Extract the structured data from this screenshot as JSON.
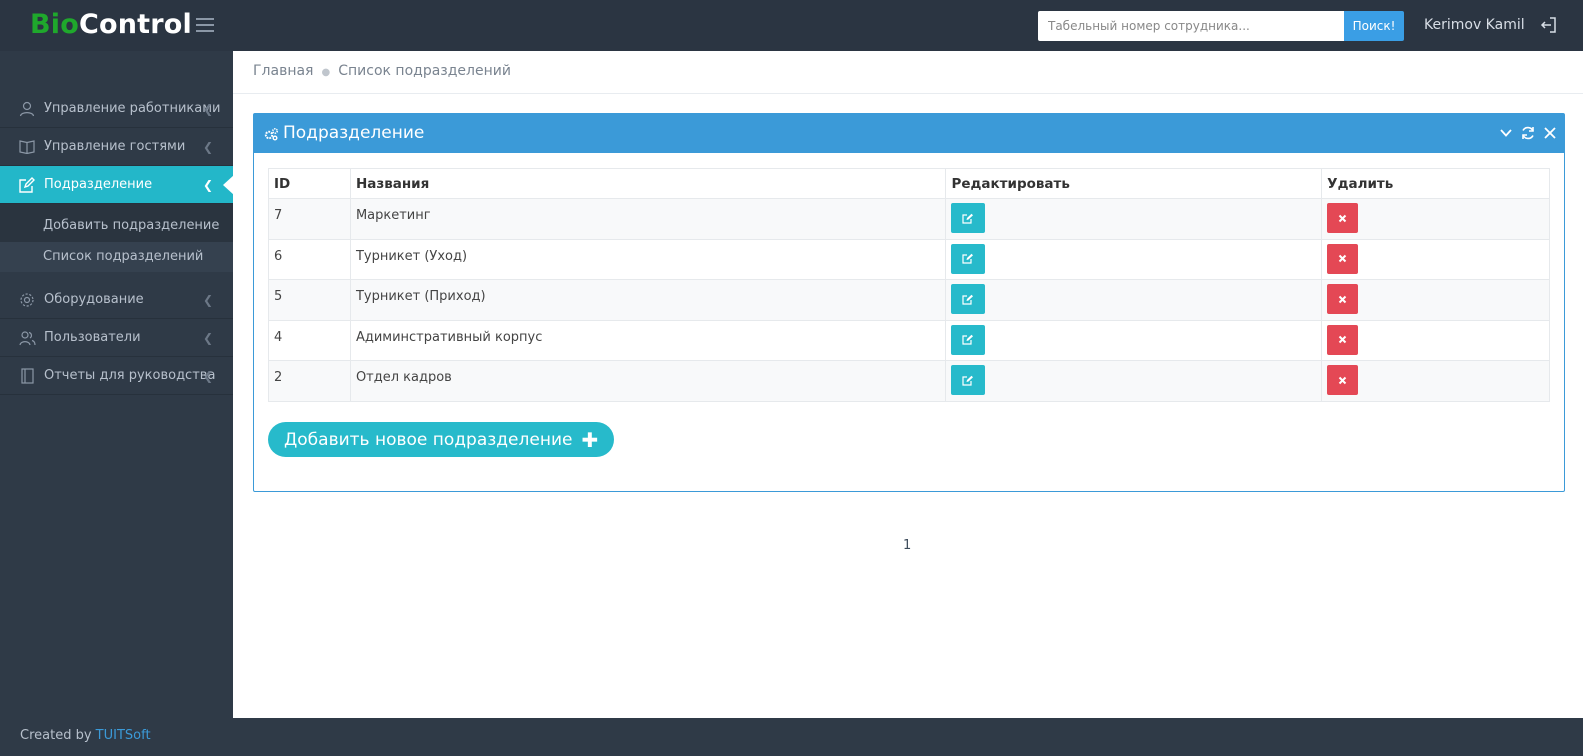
{
  "header": {
    "logo_part1": "Bio",
    "logo_part2": "Control",
    "search_placeholder": "Табельный номер сотрудника...",
    "search_button": "Поиск!",
    "username": "Kerimov Kamil"
  },
  "sidebar": {
    "items": [
      {
        "label": "Управление работниками",
        "icon": "user-icon"
      },
      {
        "label": "Управление гостями",
        "icon": "book-icon"
      },
      {
        "label": "Подразделение",
        "icon": "edit-icon"
      },
      {
        "label": "Оборудование",
        "icon": "gear-icon"
      },
      {
        "label": "Пользователи",
        "icon": "users-icon"
      },
      {
        "label": "Отчеты для руководства",
        "icon": "notebook-icon"
      }
    ],
    "subitems": [
      {
        "label": "Добавить подразделение"
      },
      {
        "label": "Список подразделений"
      }
    ]
  },
  "breadcrumb": {
    "home": "Главная",
    "current": "Список подразделений"
  },
  "panel": {
    "title": "Подразделение",
    "columns": [
      "ID",
      "Названия",
      "Редактировать",
      "Удалить"
    ],
    "rows": [
      {
        "id": "7",
        "name": "Маркетинг"
      },
      {
        "id": "6",
        "name": "Турникет (Уход)"
      },
      {
        "id": "5",
        "name": "Турникет (Приход)"
      },
      {
        "id": "4",
        "name": "Адиминстративный корпус"
      },
      {
        "id": "2",
        "name": "Отдел кадров"
      }
    ],
    "add_button": "Добавить новое подразделение"
  },
  "pagination": {
    "current_page": "1"
  },
  "footer": {
    "prefix": "Created by",
    "link": "TUITSoft"
  },
  "colors": {
    "accent": "#3b9ad8",
    "teal": "#27bacb",
    "danger": "#e44855",
    "logo_green": "#1fa82c"
  }
}
